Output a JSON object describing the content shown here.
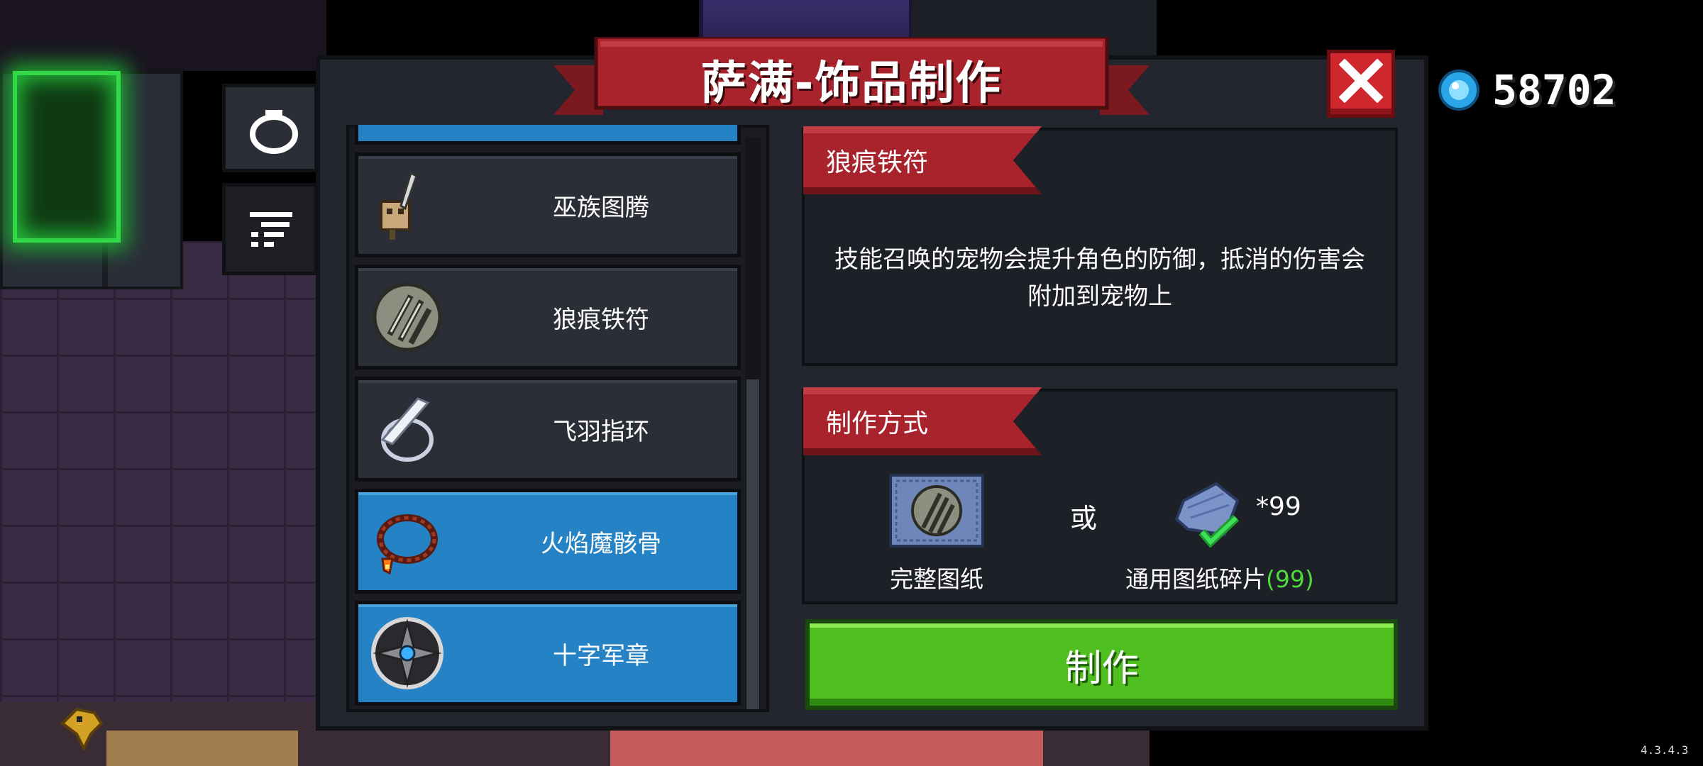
{
  "title": "萨满-饰品制作",
  "currency": {
    "icon": "gem-icon",
    "value": "58702"
  },
  "side_tabs": [
    {
      "icon": "ring-icon",
      "selected": true
    },
    {
      "icon": "recipe-list-icon",
      "selected": false
    }
  ],
  "items": [
    {
      "name": "巫族图腾",
      "icon": "totem-icon",
      "selected": false
    },
    {
      "name": "狼痕铁符",
      "icon": "claw-shield-icon",
      "selected": false
    },
    {
      "name": "飞羽指环",
      "icon": "feather-ring-icon",
      "selected": false
    },
    {
      "name": "火焰魔骸骨",
      "icon": "fire-bead-necklace-icon",
      "selected": true
    },
    {
      "name": "十字军章",
      "icon": "crusader-medal-icon",
      "selected": true
    }
  ],
  "detail": {
    "item_name": "狼痕铁符",
    "description_line1": "技能召唤的宠物会提升角色的防御，抵消的伤害会",
    "description_line2": "附加到宠物上"
  },
  "crafting": {
    "header": "制作方式",
    "option1_label": "完整图纸",
    "or_text": "或",
    "option2_count": "*99",
    "option2_label": "通用图纸碎片",
    "option2_owned": "(99)",
    "button_label": "制作"
  },
  "version": "4.3.4.3",
  "colors": {
    "banner_red": "#a8232b",
    "selected_blue": "#2583c5",
    "craft_green": "#4fbf1f",
    "owned_green": "#4fdc3a"
  }
}
